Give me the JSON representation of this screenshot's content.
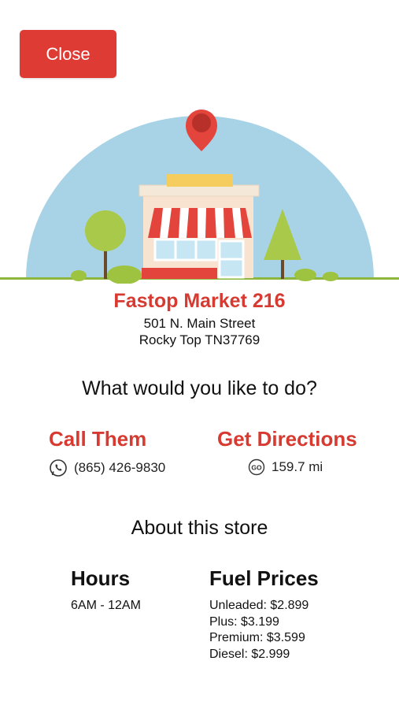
{
  "close_label": "Close",
  "store": {
    "name": "Fastop Market 216",
    "address_line1": "501 N. Main Street",
    "address_line2": "Rocky Top TN37769"
  },
  "prompt": "What would you like to do?",
  "actions": {
    "call": {
      "title": "Call Them",
      "detail": "(865) 426-9830",
      "icon": "phone-icon"
    },
    "directions": {
      "title": "Get Directions",
      "detail": "159.7 mi",
      "icon": "go-icon"
    }
  },
  "about": {
    "heading": "About this store",
    "hours_title": "Hours",
    "hours_value": "6AM - 12AM",
    "fuel_title": "Fuel Prices",
    "fuel_prices": [
      "Unleaded: $2.899",
      "Plus: $3.199",
      "Premium: $3.599",
      "Diesel: $2.999"
    ]
  },
  "colors": {
    "accent": "#d63a31",
    "button": "#de3b34",
    "sky": "#a8d3e6",
    "grass": "#8db63c"
  }
}
